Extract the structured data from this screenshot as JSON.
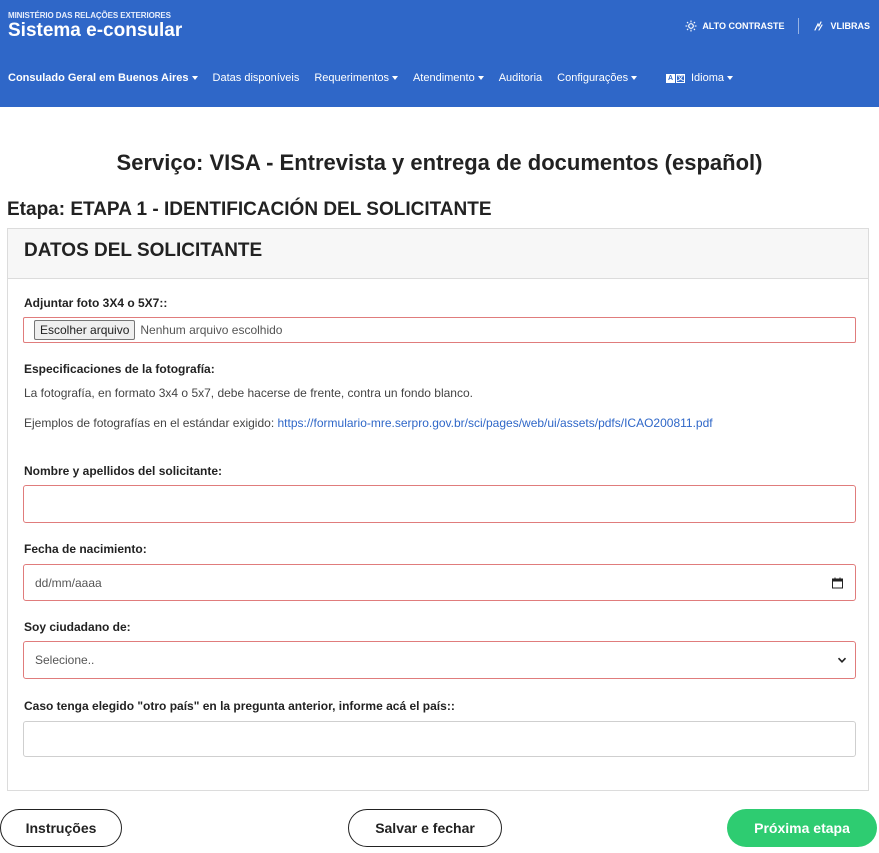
{
  "header": {
    "ministry": "MINISTÉRIO DAS RELAÇÕES EXTERIORES",
    "app_title": "Sistema e-consular",
    "high_contrast": "ALTO CONTRASTE",
    "vlibras": "VLIBRAS"
  },
  "nav": {
    "items": [
      {
        "label": "Consulado Geral em Buenos Aires",
        "dropdown": true
      },
      {
        "label": "Datas disponíveis",
        "dropdown": false
      },
      {
        "label": "Requerimentos",
        "dropdown": true
      },
      {
        "label": "Atendimento",
        "dropdown": true
      },
      {
        "label": "Auditoria",
        "dropdown": false
      },
      {
        "label": "Configurações",
        "dropdown": true
      }
    ],
    "language": "Idioma"
  },
  "page": {
    "service_title": "Serviço: VISA - Entrevista y entrega de documentos (español)",
    "stage_title": "Etapa: ETAPA 1 - IDENTIFICACIÓN DEL SOLICITANTE"
  },
  "card": {
    "title": "DATOS DEL SOLICITANTE",
    "photo_label": "Adjuntar foto 3X4 o 5X7::",
    "file_button": "Escolher arquivo",
    "file_status": "Nenhum arquivo escolhido",
    "spec_label": "Especificaciones de la fotografía:",
    "spec_text": "La fotografía, en formato 3x4 o 5x7, debe hacerse de frente, contra un fondo blanco.",
    "examples_text": "Ejemplos de fotografías en el estándar exigido: ",
    "examples_link": "https://formulario-mre.serpro.gov.br/sci/pages/web/ui/assets/pdfs/ICAO200811.pdf",
    "name_label": "Nombre y apellidos del solicitante:",
    "name_value": "",
    "birth_label": "Fecha de nacimiento:",
    "birth_placeholder": "dd/mm/aaaa",
    "citizen_label": "Soy ciudadano de:",
    "citizen_selected": "Selecione..",
    "other_country_label": "Caso tenga elegido \"otro país\" en la pregunta anterior, informe acá el país::",
    "other_country_value": ""
  },
  "buttons": {
    "instructions": "Instruções",
    "save_close": "Salvar e fechar",
    "next": "Próxima etapa"
  },
  "colors": {
    "header_bg": "#2f67c8",
    "invalid_border": "#e07c7c",
    "primary_button": "#2ecc71",
    "link": "#2f67c8"
  }
}
